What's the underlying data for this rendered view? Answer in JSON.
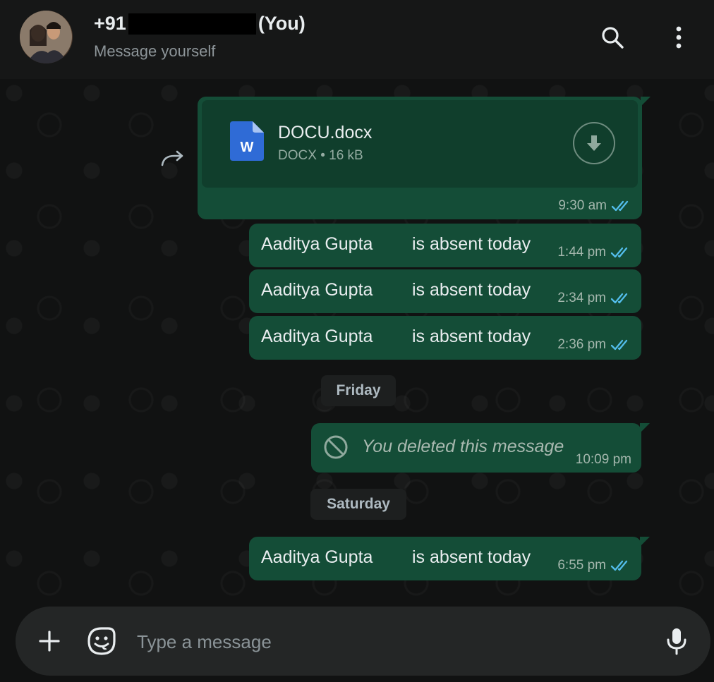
{
  "header": {
    "title_prefix": "+91",
    "title_suffix": "(You)",
    "subtitle": "Message yourself",
    "search_icon": "search-icon",
    "menu_icon": "more-vertical-icon"
  },
  "messages": [
    {
      "type": "document",
      "file_name": "DOCU.docx",
      "file_type": "DOCX",
      "separator": "•",
      "file_size": "16 kB",
      "time": "9:30 am",
      "status": "read"
    },
    {
      "type": "text",
      "text": "Aaditya Gupta        is absent today",
      "time": "1:44 pm",
      "status": "read"
    },
    {
      "type": "text",
      "text": "Aaditya Gupta        is absent today",
      "time": "2:34 pm",
      "status": "read"
    },
    {
      "type": "text",
      "text": "Aaditya Gupta        is absent today",
      "time": "2:36 pm",
      "status": "read"
    },
    {
      "type": "date",
      "label": "Friday"
    },
    {
      "type": "deleted",
      "text": "You deleted this message",
      "time": "10:09 pm"
    },
    {
      "type": "date",
      "label": "Saturday"
    },
    {
      "type": "text",
      "text": "Aaditya Gupta        is absent today",
      "time": "6:55 pm",
      "status": "read"
    }
  ],
  "composer": {
    "placeholder": "Type a message",
    "value": ""
  },
  "colors": {
    "header_bg": "#161717",
    "chat_bg": "#111212",
    "outgoing_bubble": "#144d37",
    "read_ticks": "#53bdeb",
    "composer_bg": "#242626"
  }
}
